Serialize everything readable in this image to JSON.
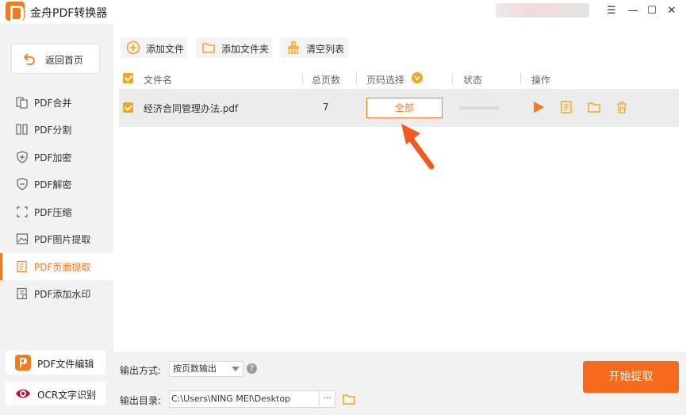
{
  "window": {
    "title": "金舟PDF转换器",
    "controls": {
      "menu": "☰",
      "minimize": "—",
      "maximize": "☐",
      "close": "✕"
    }
  },
  "sidebar": {
    "back_label": "返回首页",
    "items": [
      {
        "label": "PDF合并",
        "icon": "merge-icon"
      },
      {
        "label": "PDF分割",
        "icon": "split-icon"
      },
      {
        "label": "PDF加密",
        "icon": "lock-shield-icon"
      },
      {
        "label": "PDF解密",
        "icon": "unlock-shield-icon"
      },
      {
        "label": "PDF压缩",
        "icon": "compress-icon"
      },
      {
        "label": "PDF图片提取",
        "icon": "image-icon"
      },
      {
        "label": "PDF页面提取",
        "icon": "page-extract-icon",
        "active": true
      },
      {
        "label": "PDF添加水印",
        "icon": "watermark-icon"
      }
    ],
    "bottom": [
      {
        "label": "PDF文件编辑",
        "icon": "pdf-editor-icon"
      },
      {
        "label": "OCR文字识别",
        "icon": "ocr-eye-icon"
      }
    ]
  },
  "toolbar": {
    "add_file": "添加文件",
    "add_folder": "添加文件夹",
    "clear_list": "清空列表"
  },
  "table": {
    "headers": {
      "filename": "文件名",
      "pages": "总页数",
      "page_select": "页码选择",
      "status": "状态",
      "actions": "操作"
    },
    "rows": [
      {
        "filename": "经济合同管理办法.pdf",
        "pages": "7",
        "page_select": "全部"
      }
    ]
  },
  "bottom": {
    "output_mode_label": "输出方式:",
    "output_mode_value": "按页数输出",
    "output_dir_label": "输出目录:",
    "output_dir_value": "C:\\Users\\NING MEI\\Desktop",
    "browse": "···",
    "help": "?",
    "start": "开始提取"
  },
  "colors": {
    "accent": "#f47a20",
    "start_button": "#f56a1d",
    "checkbox": "#f4a51c",
    "sidebar_bg": "#f2f2f2",
    "arrow": "#f2591f"
  }
}
